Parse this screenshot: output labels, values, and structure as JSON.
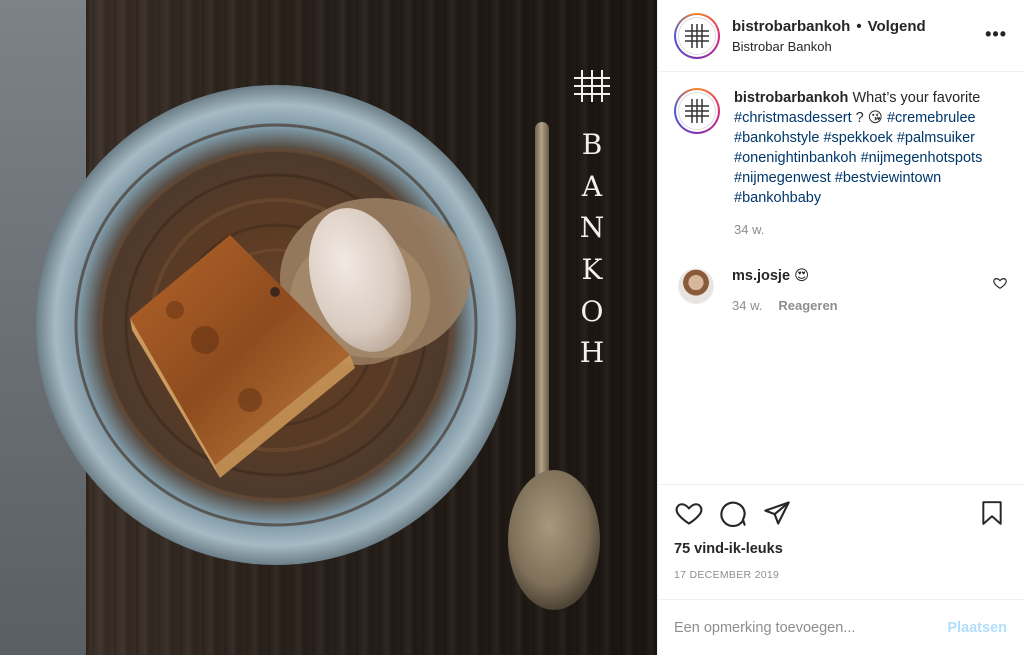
{
  "header": {
    "username": "bistrobarbankoh",
    "separator": "•",
    "follow_status": "Volgend",
    "subtitle": "Bistrobar Bankoh",
    "more_label": "•••"
  },
  "photo": {
    "logo_letters": [
      "B",
      "A",
      "N",
      "K",
      "O",
      "H"
    ]
  },
  "caption": {
    "username": "bistrobarbankoh",
    "text": "What’s your favorite",
    "tag1": "#christmasdessert",
    "mid": " ? 😘 ",
    "tag2": "#cremebrulee",
    "tags_line": [
      "#bankohstyle",
      "#spekkoek",
      "#palmsuiker",
      "#onenightinbankoh",
      "#nijmegenhotspots",
      "#nijmegenwest",
      "#bestviewintown",
      "#bankohbaby"
    ],
    "time": "34 w."
  },
  "comments": [
    {
      "username": "ms.josje",
      "text": "😍",
      "time": "34 w.",
      "reply": "Reageren"
    }
  ],
  "actions": {
    "likes": "75 vind-ik-leuks",
    "date": "17 DECEMBER 2019"
  },
  "comment_box": {
    "placeholder": "Een opmerking toevoegen...",
    "post_label": "Plaatsen"
  },
  "colors": {
    "hashtag": "#00376b",
    "muted": "#8e8e8e",
    "post_button": "#b2dffc"
  }
}
